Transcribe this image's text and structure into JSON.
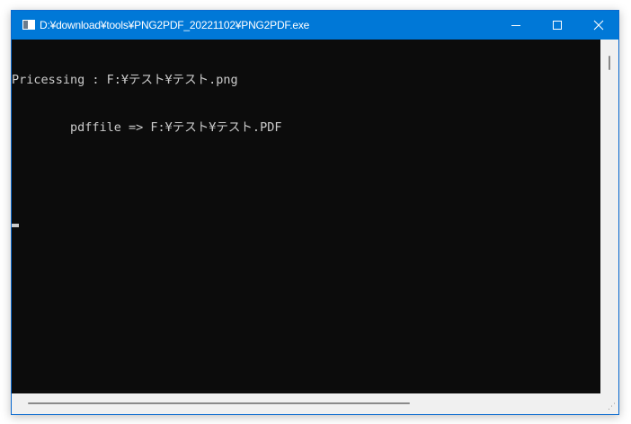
{
  "window": {
    "title": "D:¥download¥tools¥PNG2PDF_20221102¥PNG2PDF.exe",
    "buttons": {
      "minimize_icon": "minimize-icon",
      "maximize_icon": "maximize-icon",
      "close_icon": "close-icon"
    }
  },
  "console": {
    "lines": [
      "Pricessing : F:¥テスト¥テスト.png",
      "        pdffile => F:¥テスト¥テスト.PDF",
      ""
    ],
    "background": "#0c0c0c",
    "foreground": "#cccccc"
  },
  "colors": {
    "titlebar": "#0078d7",
    "scrollbar": "#f0f0f0"
  }
}
